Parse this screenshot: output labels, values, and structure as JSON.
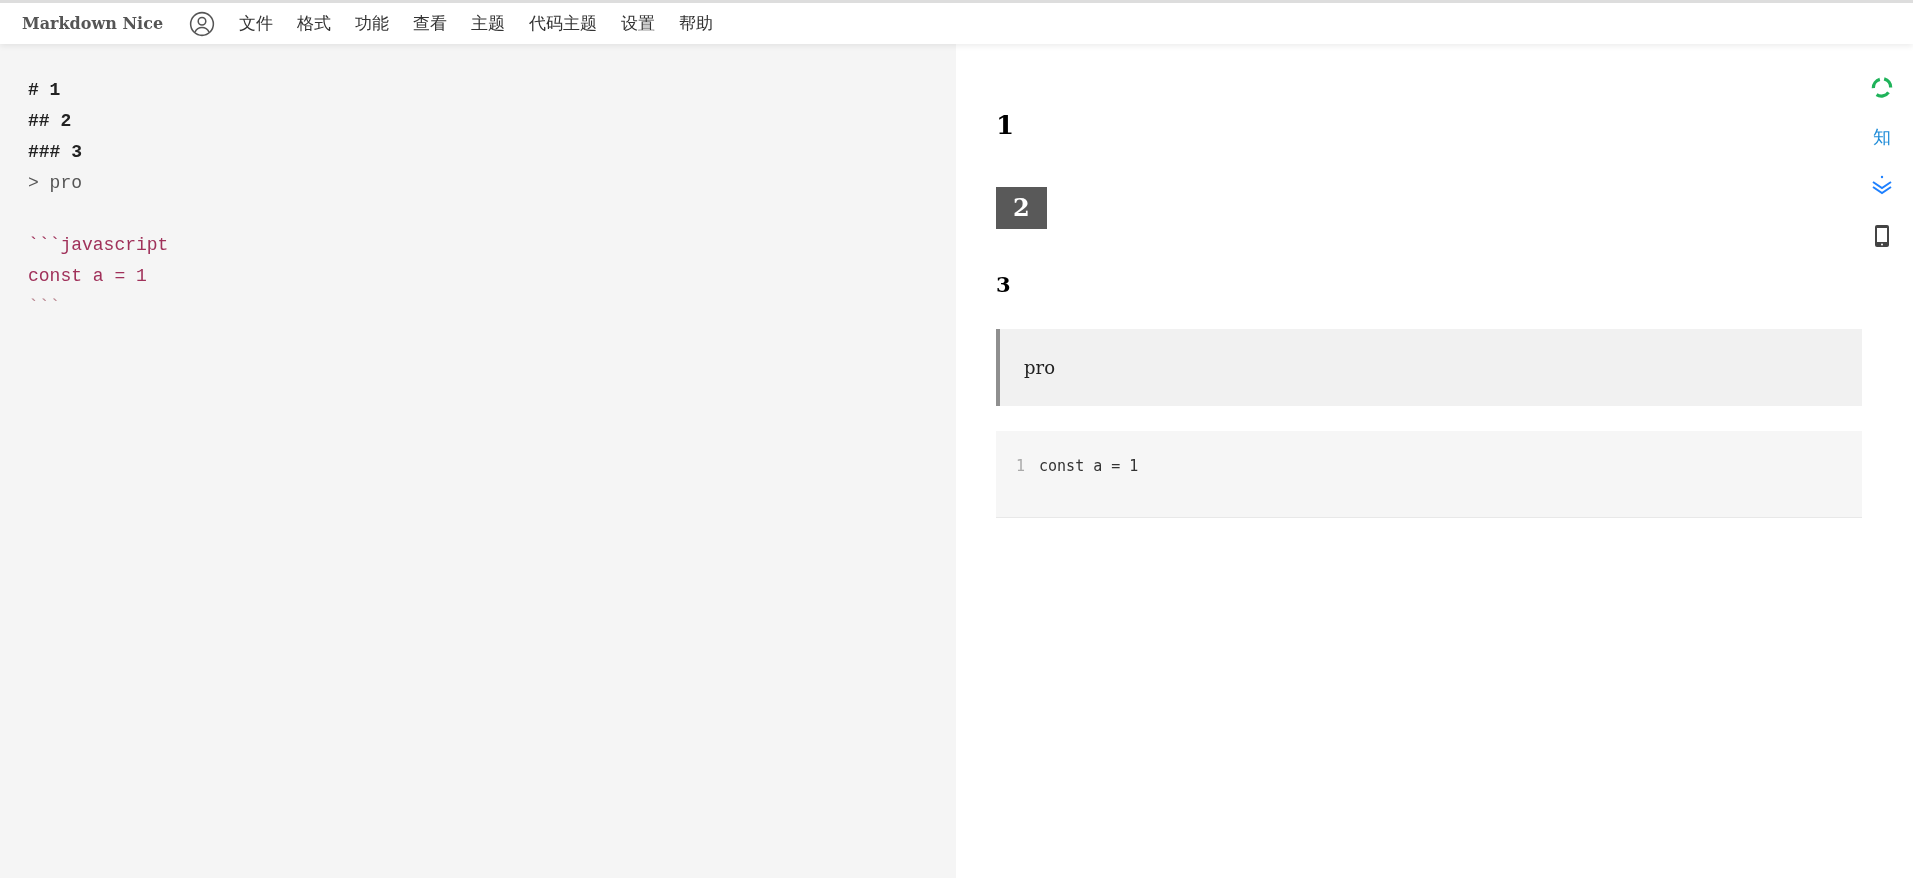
{
  "menu_bar": {
    "app_title": "Markdown Nice",
    "items": [
      "文件",
      "格式",
      "功能",
      "查看",
      "主题",
      "代码主题",
      "设置",
      "帮助"
    ]
  },
  "editor": {
    "lines": [
      {
        "kind": "heading",
        "text": "# 1"
      },
      {
        "kind": "heading",
        "text": "## 2"
      },
      {
        "kind": "heading",
        "text": "### 3"
      },
      {
        "kind": "quote",
        "text": "> pro"
      },
      {
        "kind": "blank"
      },
      {
        "kind": "code",
        "text": "```javascript"
      },
      {
        "kind": "code",
        "text": "const a = 1"
      },
      {
        "kind": "fence",
        "text": "```"
      }
    ]
  },
  "preview": {
    "h1": "1",
    "h2": "2",
    "h3": "3",
    "blockquote": "pro",
    "code_block": {
      "lines": [
        {
          "number": "1",
          "code": "const a = 1"
        }
      ]
    }
  },
  "side_tools": {
    "zhihu_label": "知"
  }
}
